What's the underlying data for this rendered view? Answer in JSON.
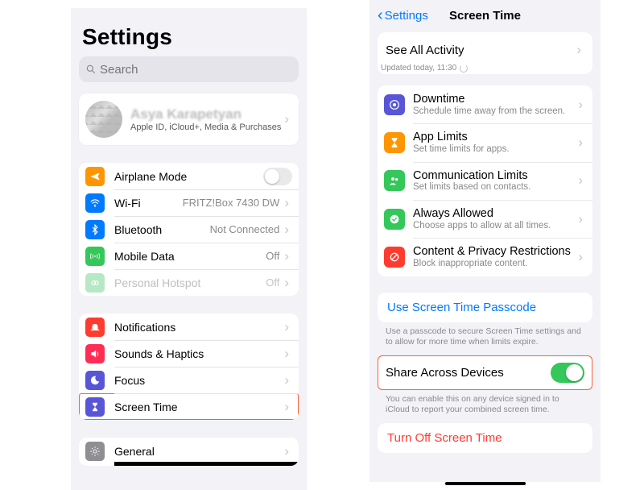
{
  "left": {
    "title": "Settings",
    "search_placeholder": "Search",
    "profile": {
      "name": "Asya Karapetyan",
      "sub": "Apple ID, iCloud+, Media & Purchases"
    },
    "g1": {
      "airplane": "Airplane Mode",
      "wifi": "Wi-Fi",
      "wifi_val": "FRITZ!Box 7430 DW",
      "bt": "Bluetooth",
      "bt_val": "Not Connected",
      "mobile": "Mobile Data",
      "mobile_val": "Off",
      "hotspot": "Personal Hotspot",
      "hotspot_val": "Off"
    },
    "g2": {
      "notif": "Notifications",
      "sounds": "Sounds & Haptics",
      "focus": "Focus",
      "screentime": "Screen Time"
    },
    "g3": {
      "general": "General"
    }
  },
  "right": {
    "back": "Settings",
    "title": "Screen Time",
    "see_all": "See All Activity",
    "updated": "Updated today, 11:30",
    "items": {
      "downtime": {
        "t": "Downtime",
        "s": "Schedule time away from the screen."
      },
      "applimits": {
        "t": "App Limits",
        "s": "Set time limits for apps."
      },
      "comms": {
        "t": "Communication Limits",
        "s": "Set limits based on contacts."
      },
      "always": {
        "t": "Always Allowed",
        "s": "Choose apps to allow at all times."
      },
      "content": {
        "t": "Content & Privacy Restrictions",
        "s": "Block inappropriate content."
      }
    },
    "passcode": "Use Screen Time Passcode",
    "passcode_note": "Use a passcode to secure Screen Time settings and to allow for more time when limits expire.",
    "share": "Share Across Devices",
    "share_note": "You can enable this on any device signed in to iCloud to report your combined screen time.",
    "turnoff": "Turn Off Screen Time"
  }
}
